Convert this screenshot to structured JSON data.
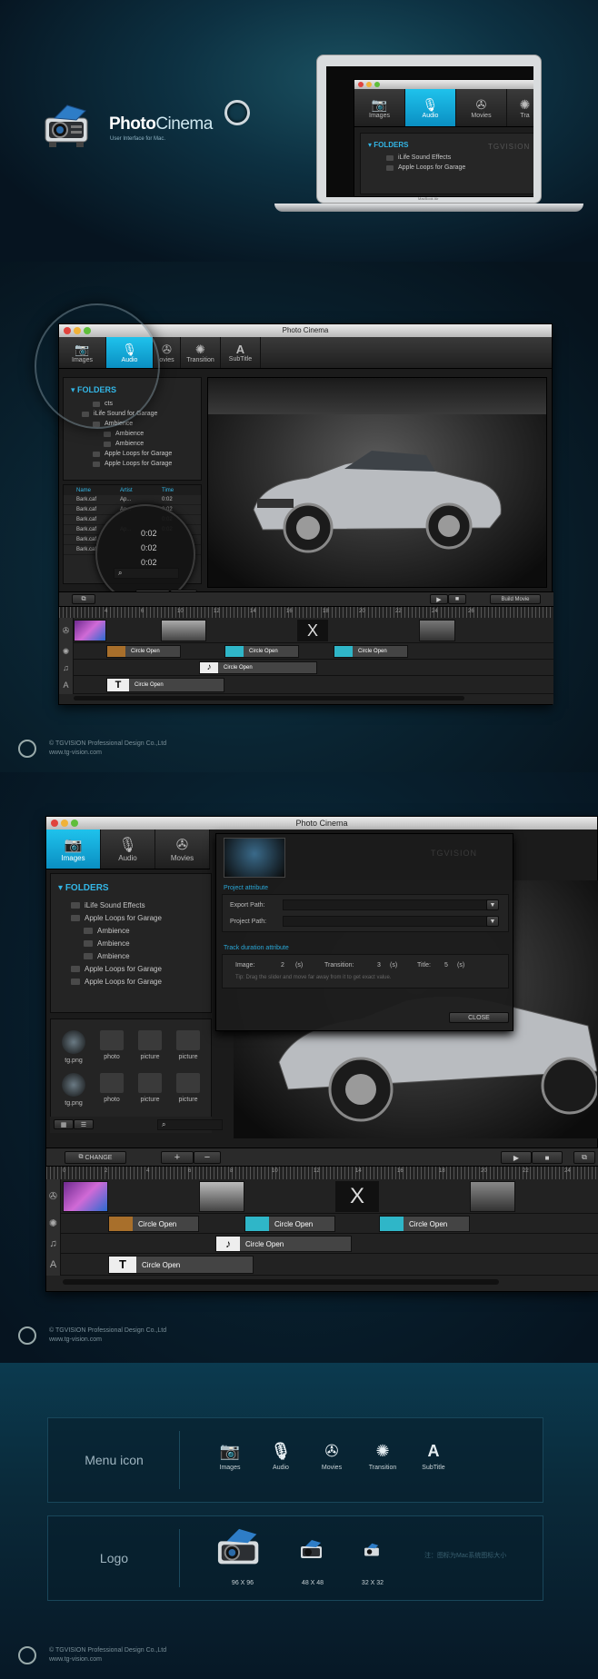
{
  "brand": {
    "name_bold": "Photo",
    "name_light": "Cinema",
    "subtitle": "User Interface for Mac."
  },
  "laptop": {
    "label": "MacBook Air"
  },
  "mini": {
    "tabs": [
      "Images",
      "Audio",
      "Movies",
      "Tra"
    ],
    "folders_title": "FOLDERS",
    "items": [
      "iLife Sound Effects",
      "Apple Loops for Garage"
    ],
    "watermark": "TGVISION"
  },
  "win1": {
    "title": "Photo Cinema",
    "tabs": [
      "Images",
      "Audio",
      "ovies",
      "Transition",
      "SubTitle"
    ],
    "folders_title": "FOLDERS",
    "tree": [
      {
        "label": "cts",
        "indent": 2
      },
      {
        "label": "iLife Sound for Garage",
        "indent": 1
      },
      {
        "label": "Ambience",
        "indent": 2
      },
      {
        "label": "Ambience",
        "indent": 3
      },
      {
        "label": "Ambience",
        "indent": 3
      },
      {
        "label": "Apple Loops for Garage",
        "indent": 2
      },
      {
        "label": "Apple Loops for Garage",
        "indent": 2
      }
    ],
    "columns": [
      "Name",
      "Artist",
      "Time"
    ],
    "rows": [
      {
        "name": "Bark.caf",
        "artist": "Ap...",
        "time": "0:02"
      },
      {
        "name": "Bark.caf",
        "artist": "Ap...",
        "time": "0:02"
      },
      {
        "name": "Bark.caf",
        "artist": "",
        "time": "0:02"
      },
      {
        "name": "Bark.caf",
        "artist": "Ap...",
        "time": "0:02"
      },
      {
        "name": "Bark.caf",
        "artist": "",
        "time": ""
      },
      {
        "name": "Bark.caf",
        "artist": "",
        "time": ""
      }
    ],
    "zoom_times": [
      "0:02",
      "0:02",
      "0:02"
    ],
    "build_movie": "Build Movie",
    "ruler": [
      "4",
      "6",
      "10",
      "12",
      "14",
      "16",
      "18",
      "20",
      "22",
      "24",
      "26"
    ],
    "clips": [
      "Circle Open",
      "Circle Open",
      "Circle Open",
      "Circle Open",
      "Circle Open"
    ]
  },
  "footer": {
    "company": "© TGVISION Professional Design Co.,Ltd",
    "url": "www.tg-vision.com"
  },
  "win2": {
    "title": "Photo Cinema",
    "tabs": [
      "Images",
      "Audio",
      "Movies"
    ],
    "folders_title": "FOLDERS",
    "tree": [
      {
        "label": "iLife Sound Effects",
        "indent": 1
      },
      {
        "label": "Apple Loops for Garage",
        "indent": 1
      },
      {
        "label": "Ambience",
        "indent": 2
      },
      {
        "label": "Ambience",
        "indent": 2
      },
      {
        "label": "Ambience",
        "indent": 2
      },
      {
        "label": "Apple Loops for Garage",
        "indent": 1
      },
      {
        "label": "Apple Loops for Garage",
        "indent": 1
      }
    ],
    "files": [
      "tg.png",
      "photo",
      "picture",
      "picture",
      "tg.png",
      "photo",
      "picture",
      "picture"
    ],
    "change": "CHANGE",
    "ruler": [
      "0",
      "2",
      "4",
      "6",
      "8",
      "10",
      "12",
      "14",
      "16",
      "18",
      "20",
      "22",
      "24"
    ],
    "clips": [
      "Circle Open",
      "Circle Open",
      "Circle Open",
      "Circle Open",
      "Circle Open"
    ],
    "dialog": {
      "project_attr": "Project attribute",
      "export_label": "Export Path:",
      "project_label": "Project Path:",
      "track_attr": "Track duration attribute",
      "image_label": "Image:",
      "image_val": "2",
      "image_unit": "(s)",
      "transition_label": "Transition:",
      "transition_val": "3",
      "transition_unit": "(s)",
      "title_label": "Title:",
      "title_val": "5",
      "title_unit": "(s)",
      "tip": "Tip: Drag the slider and move far away from it to get exact value.",
      "close": "CLOSE"
    },
    "watermark": "TGVISION"
  },
  "menu_box": {
    "title": "Menu icon",
    "icons": [
      {
        "label": "Images",
        "icon": "camera-icon"
      },
      {
        "label": "Audio",
        "icon": "microphone-icon"
      },
      {
        "label": "Movies",
        "icon": "film-reel-icon"
      },
      {
        "label": "Transition",
        "icon": "sparkle-icon"
      },
      {
        "label": "SubTitle",
        "icon": "font-icon"
      }
    ]
  },
  "logo_box": {
    "title": "Logo",
    "sizes": [
      "96 X 96",
      "48 X 48",
      "32 X 32"
    ],
    "note": "注：图标为Mac系统图标大小"
  },
  "colors": {
    "accent": "#1fb6e6",
    "background": "#071826"
  }
}
